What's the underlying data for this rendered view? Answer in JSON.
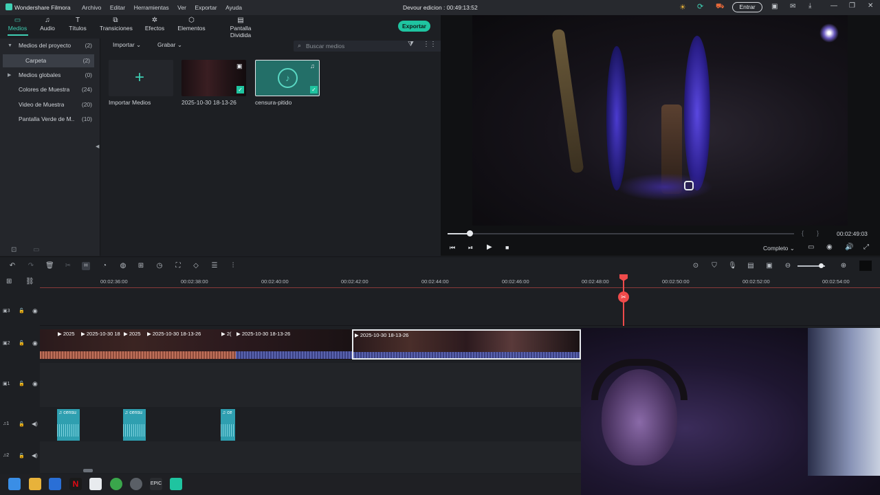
{
  "app": {
    "name": "Wondershare Filmora",
    "window_title": "Devour edicion : 00:49:13:52",
    "menu": [
      "Archivo",
      "Editar",
      "Herramientas",
      "Ver",
      "Exportar",
      "Ayuda"
    ],
    "login_button": "Entrar"
  },
  "tabs": [
    {
      "label": "Medios",
      "icon": "folder-icon",
      "active": true
    },
    {
      "label": "Audio",
      "icon": "music-note-icon"
    },
    {
      "label": "Títulos",
      "icon": "text-icon"
    },
    {
      "label": "Transiciones",
      "icon": "transition-icon"
    },
    {
      "label": "Efectos",
      "icon": "effects-icon"
    },
    {
      "label": "Elementos",
      "icon": "elements-icon"
    },
    {
      "label": "Pantalla Dividida",
      "icon": "split-screen-icon"
    }
  ],
  "export_label": "Exportar",
  "sidebar": {
    "items": [
      {
        "label": "Medios del proyecto",
        "count": "(2)",
        "arrow": "▼"
      },
      {
        "label": "Carpeta",
        "count": "(2)",
        "selected": true
      },
      {
        "label": "Medios globales",
        "count": "(0)",
        "arrow": "▶"
      },
      {
        "label": "Colores de Muestra",
        "count": "(24)"
      },
      {
        "label": "Video de Muestra",
        "count": "(20)"
      },
      {
        "label": "Pantalla Verde de M...",
        "count": "(10)"
      }
    ]
  },
  "media": {
    "import_label": "Importar",
    "record_label": "Grabar",
    "search_placeholder": "Buscar medios",
    "items": [
      {
        "label": "Importar Medios"
      },
      {
        "label": "2025-10-30 18-13-26"
      },
      {
        "label": "censura-pitido"
      }
    ]
  },
  "preview": {
    "timecode": "00:02:49:03",
    "quality": "Completo",
    "progress": 0.06
  },
  "ruler": {
    "ticks": [
      "00:02:36:00",
      "00:02:38:00",
      "00:02:40:00",
      "00:02:42:00",
      "00:02:44:00",
      "00:02:46:00",
      "00:02:48:00",
      "00:02:50:00",
      "00:02:52:00",
      "00:02:54:00"
    ]
  },
  "tracks": {
    "labels": [
      "3",
      "2",
      "1",
      "1",
      "2"
    ],
    "video_clips": [
      "2025",
      "2025-10-30 18",
      "2025",
      "2025-10-30 18-13-26",
      "2(",
      "2025-10-30 18-13-26",
      "2025-10-30 18-13-26"
    ],
    "audio_clips": [
      "censu",
      "censu",
      "ce"
    ]
  },
  "colors": {
    "accent": "#3fd0b4",
    "playhead": "#ef4b4b",
    "audio_clip": "#2f9fb0"
  }
}
